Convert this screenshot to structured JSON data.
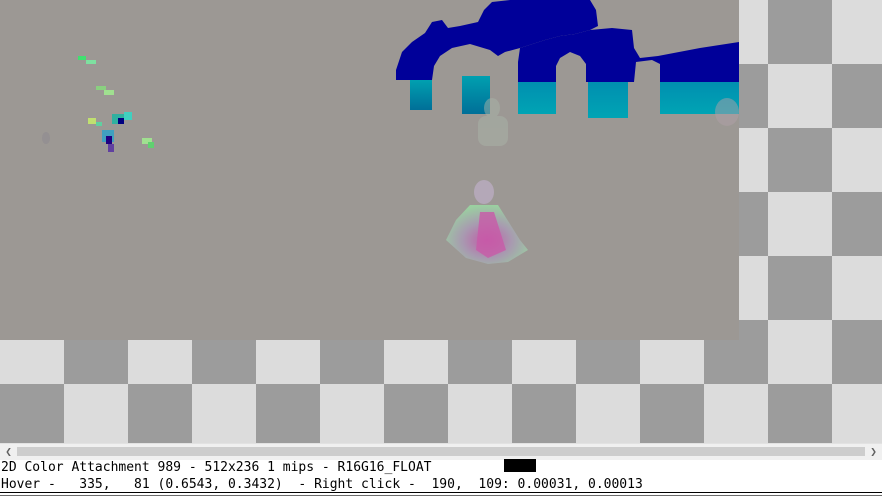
{
  "texture_info": {
    "text": "2D Color Attachment 989 - 512x236 1 mips - R16G16_FLOAT",
    "swatch_color": "#000000"
  },
  "hover_info": {
    "text": "Hover -   335,   81 (0.6543, 0.3432)  - Right click -  190,  109: 0.00031, 0.00013"
  },
  "colors": {
    "texture_background": "#9c9894",
    "checker_light": "#dcdcdc",
    "checker_dark": "#9c9c9c",
    "deep_blue": "#000099",
    "teal": "#0098a8"
  },
  "scrollbar": {
    "left_icon": "chevron-left-icon",
    "right_icon": "chevron-right-icon"
  }
}
